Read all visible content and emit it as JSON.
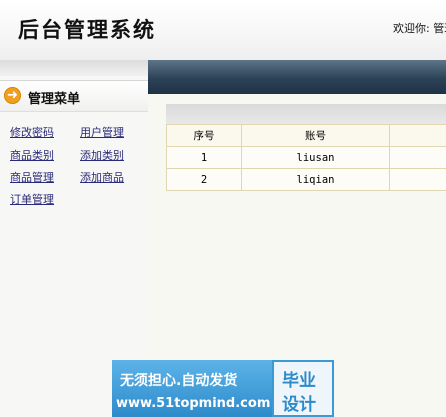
{
  "header": {
    "title": "后台管理系统",
    "welcome": "欢迎你: 管理员"
  },
  "sidebar": {
    "menu_title": "管理菜单",
    "icon": "arrow-right-circle-icon",
    "links": [
      {
        "label": "修改密码"
      },
      {
        "label": "用户管理"
      },
      {
        "label": "商品类别"
      },
      {
        "label": "添加类别"
      },
      {
        "label": "商品管理"
      },
      {
        "label": "添加商品"
      },
      {
        "label": "订单管理"
      }
    ]
  },
  "table": {
    "columns": [
      "序号",
      "账号"
    ],
    "rows": [
      [
        "1",
        "liusan"
      ],
      [
        "2",
        "liqian"
      ]
    ]
  },
  "banner": {
    "line1": "无须担心.自动发货",
    "line2": "www.51topmind.com",
    "word1": "毕业",
    "word2": "设计"
  },
  "colors": {
    "header_bar": "#2c4257",
    "link": "#2a2a7a",
    "icon_orange": "#f0a020",
    "banner_blue": "#3a9ad6"
  }
}
